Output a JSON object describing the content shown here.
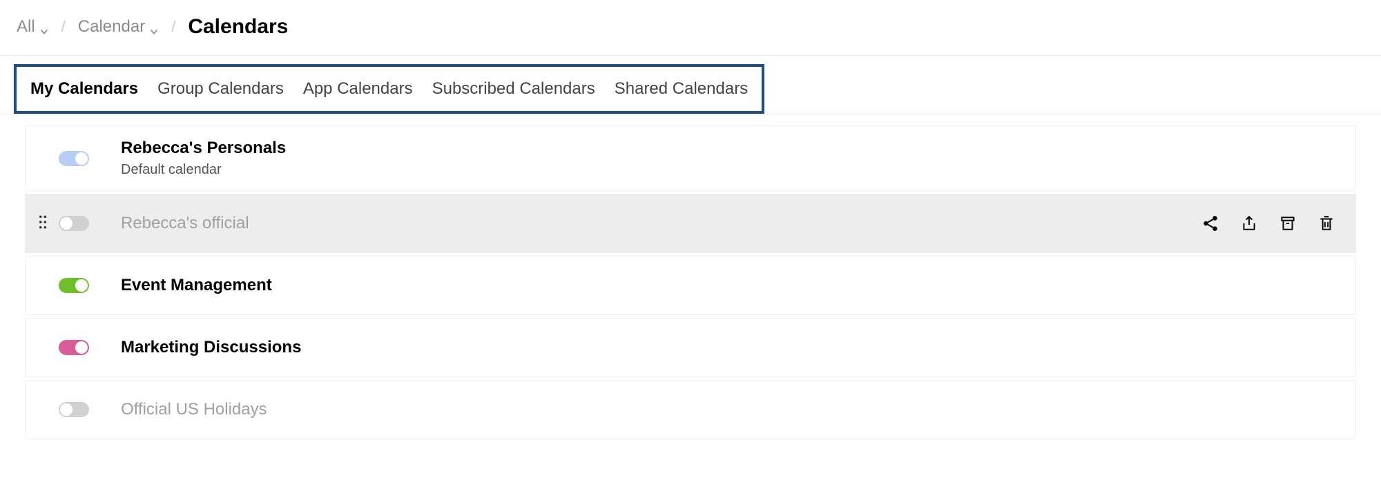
{
  "breadcrumb": {
    "root": "All",
    "parent": "Calendar",
    "title": "Calendars"
  },
  "tabs": [
    {
      "label": "My Calendars",
      "active": true
    },
    {
      "label": "Group Calendars",
      "active": false
    },
    {
      "label": "App Calendars",
      "active": false
    },
    {
      "label": "Subscribed Calendars",
      "active": false
    },
    {
      "label": "Shared Calendars",
      "active": false
    }
  ],
  "calendars": [
    {
      "name": "Rebecca's Personals",
      "subtitle": "Default calendar",
      "on": true,
      "color": "#b7cdf4",
      "muted": false,
      "hovered": false,
      "disabled": true
    },
    {
      "name": "Rebecca's official",
      "subtitle": "",
      "on": false,
      "color": "#d0d0d0",
      "muted": true,
      "hovered": true,
      "disabled": false
    },
    {
      "name": "Event Management",
      "subtitle": "",
      "on": true,
      "color": "#6fbf2d",
      "muted": false,
      "hovered": false,
      "disabled": false
    },
    {
      "name": "Marketing Discussions",
      "subtitle": "",
      "on": true,
      "color": "#d85d96",
      "muted": false,
      "hovered": false,
      "disabled": false
    },
    {
      "name": "Official US Holidays",
      "subtitle": "",
      "on": false,
      "color": "#d0d0d0",
      "muted": true,
      "hovered": false,
      "disabled": false
    }
  ]
}
